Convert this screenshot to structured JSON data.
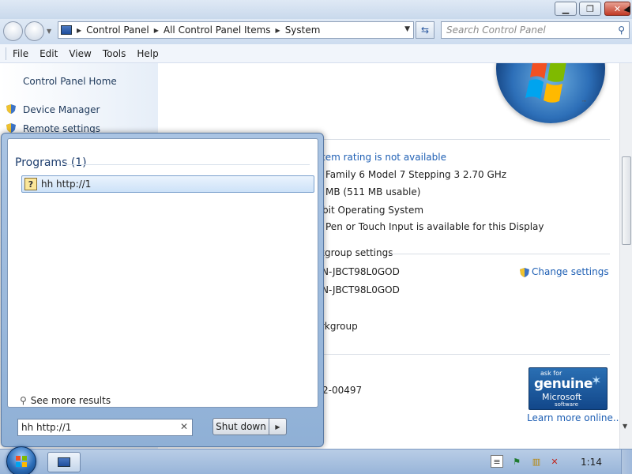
{
  "window": {
    "minimize_glyph": "▁",
    "maximize_glyph": "❐",
    "close_glyph": "✕"
  },
  "address": {
    "crumbs": [
      "Control Panel",
      "All Control Panel Items",
      "System"
    ],
    "search_placeholder": "Search Control Panel"
  },
  "menu": {
    "items": [
      "File",
      "Edit",
      "View",
      "Tools",
      "Help"
    ]
  },
  "sidebar": {
    "home": "Control Panel Home",
    "links": [
      "Device Manager",
      "Remote settings"
    ]
  },
  "content": {
    "rating": "tem rating is not available",
    "processor": "Family 6 Model 7 Stepping 3   2.70 GHz",
    "memory": "MB (511 MB usable)",
    "system_type": "bit Operating System",
    "pen_touch": "Pen or Touch Input is available for this Display",
    "workgroup_header": "kgroup settings",
    "computer_name": "N-JBCT98L0GOD",
    "full_name": "N-JBCT98L0GOD",
    "workgroup": "rkgroup",
    "product_id": "2-00497",
    "change_settings": "Change settings",
    "learn_more": "Learn more online..."
  },
  "genuine": {
    "ask_for": "ask for",
    "genuine": "genuine",
    "microsoft": "Microsoft",
    "software": "software"
  },
  "start_menu": {
    "programs_header": "Programs (1)",
    "result": "hh http://1",
    "see_more": "See more results",
    "search_value": "hh http://1",
    "shutdown_label": "Shut down"
  },
  "taskbar": {
    "clock": "1:14"
  },
  "colors": {
    "link": "#1e5fb4",
    "close_button": "#c13a26"
  }
}
